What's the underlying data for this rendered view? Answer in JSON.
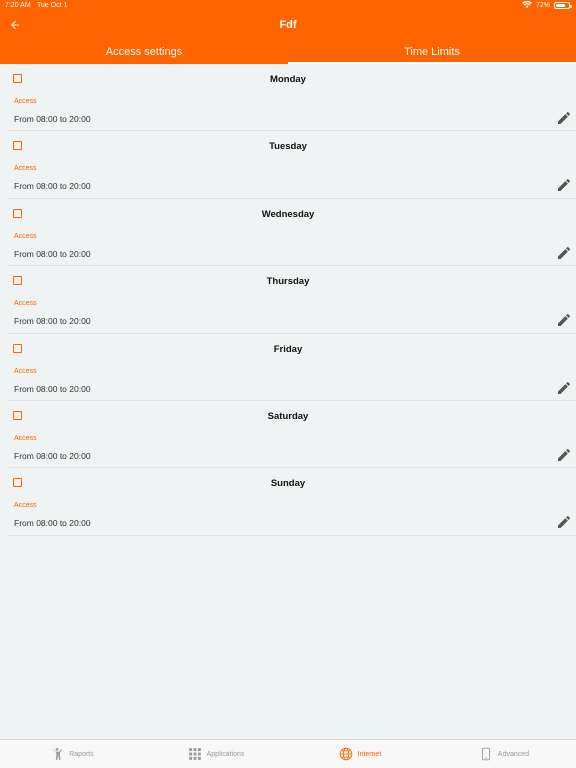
{
  "status_bar": {
    "time": "7:20 AM",
    "date": "Tue Oct 1",
    "battery": "72%"
  },
  "header": {
    "title": "Fdf"
  },
  "tabs": [
    {
      "label": "Access settings",
      "active": false
    },
    {
      "label": "Time Limits",
      "active": true
    }
  ],
  "days": [
    {
      "name": "Monday",
      "access_label": "Access",
      "access_value": "From 08:00 to 20:00"
    },
    {
      "name": "Tuesday",
      "access_label": "Access",
      "access_value": "From 08:00 to 20:00"
    },
    {
      "name": "Wednesday",
      "access_label": "Access",
      "access_value": "From 08:00 to 20:00"
    },
    {
      "name": "Thursday",
      "access_label": "Access",
      "access_value": "From 08:00 to 20:00"
    },
    {
      "name": "Friday",
      "access_label": "Access",
      "access_value": "From 08:00 to 20:00"
    },
    {
      "name": "Saturday",
      "access_label": "Access",
      "access_value": "From 08:00 to 20:00"
    },
    {
      "name": "Sunday",
      "access_label": "Access",
      "access_value": "From 08:00 to 20:00"
    }
  ],
  "bottom_nav": [
    {
      "label": "Raports",
      "icon": "person-icon",
      "active": false
    },
    {
      "label": "Applications",
      "icon": "grid-icon",
      "active": false
    },
    {
      "label": "Internet",
      "icon": "globe-icon",
      "active": true
    },
    {
      "label": "Advanced",
      "icon": "tablet-icon",
      "active": false
    }
  ],
  "colors": {
    "accent": "#ff6400",
    "background": "#eff3f3"
  }
}
